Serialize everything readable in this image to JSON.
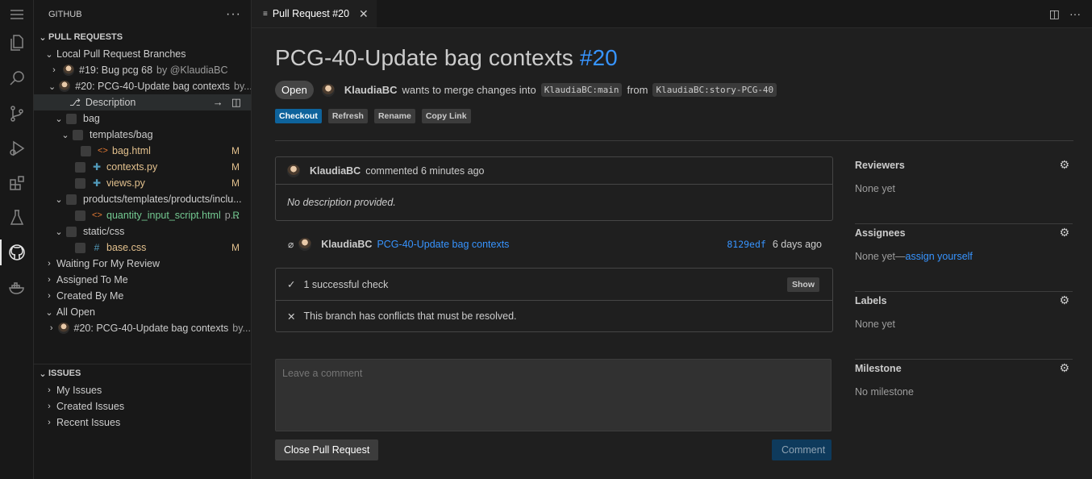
{
  "sidebar": {
    "title": "GITHUB",
    "pull_requests_title": "PULL REQUESTS",
    "local_branches": "Local Pull Request Branches",
    "pr19": {
      "label": "#19: Bug pcg 68",
      "by": "by @KlaudiaBC"
    },
    "pr20": {
      "label": "#20: PCG-40-Update bag contexts",
      "by": "by..."
    },
    "description": "Description",
    "tree": {
      "bag": "bag",
      "templates_bag": "templates/bag",
      "bag_html": "bag.html",
      "contexts_py": "contexts.py",
      "views_py": "views.py",
      "products_folder": "products/templates/products/inclu...",
      "quantity_file": "quantity_input_script.html",
      "quantity_suffix": "p...",
      "static_css": "static/css",
      "base_css": "base.css",
      "mod_m": "M",
      "mod_r": "R"
    },
    "waiting": "Waiting For My Review",
    "assigned": "Assigned To Me",
    "created": "Created By Me",
    "all_open": "All Open",
    "all_open_pr20": {
      "label": "#20: PCG-40-Update bag contexts",
      "by": "by..."
    },
    "issues_title": "ISSUES",
    "my_issues": "My Issues",
    "created_issues": "Created Issues",
    "recent_issues": "Recent Issues"
  },
  "tab": {
    "label": "Pull Request #20"
  },
  "pr": {
    "title": "PCG-40-Update bag contexts",
    "number": "#20",
    "state": "Open",
    "author": "KlaudiaBC",
    "merge_text": "wants to merge changes into",
    "base_branch": "KlaudiaBC:main",
    "from_text": "from",
    "head_branch": "KlaudiaBC:story-PCG-40",
    "buttons": {
      "checkout": "Checkout",
      "refresh": "Refresh",
      "rename": "Rename",
      "copy_link": "Copy Link"
    }
  },
  "timeline": {
    "comment_author": "KlaudiaBC",
    "comment_meta": "commented 6 minutes ago",
    "comment_body": "No description provided.",
    "commit_author": "KlaudiaBC",
    "commit_message": "PCG-40-Update bag contexts",
    "commit_sha": "8129edf",
    "commit_time": "6 days ago",
    "checks_text": "1 successful check",
    "show_label": "Show",
    "conflict_text": "This branch has conflicts that must be resolved.",
    "comment_placeholder": "Leave a comment",
    "close_button": "Close Pull Request",
    "comment_button": "Comment"
  },
  "side": {
    "reviewers_label": "Reviewers",
    "reviewers_value": "None yet",
    "assignees_label": "Assignees",
    "assignees_value": "None yet—",
    "assign_yourself": "assign yourself",
    "labels_label": "Labels",
    "labels_value": "None yet",
    "milestone_label": "Milestone",
    "milestone_value": "No milestone"
  },
  "icons": [
    "menu-icon",
    "explorer-icon",
    "search-icon",
    "source-control-icon",
    "run-debug-icon",
    "extensions-icon",
    "testing-icon",
    "github-icon",
    "docker-icon"
  ]
}
